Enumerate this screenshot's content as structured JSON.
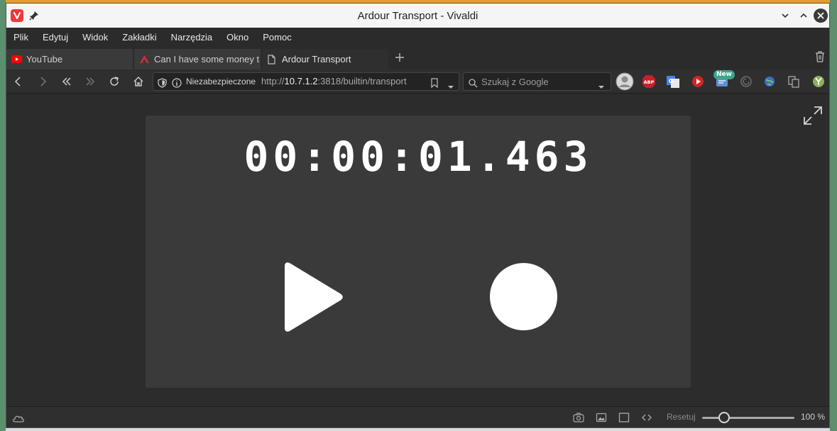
{
  "window": {
    "title": "Ardour Transport - Vivaldi"
  },
  "menu": {
    "items": [
      "Plik",
      "Edytuj",
      "Widok",
      "Zakładki",
      "Narzędzia",
      "Okno",
      "Pomoc"
    ]
  },
  "tabs": [
    {
      "label": "YouTube",
      "icon": "youtube-icon",
      "active": false
    },
    {
      "label": "Can I have some money t…",
      "icon": "ardour-icon",
      "active": false
    },
    {
      "label": "Ardour Transport",
      "icon": "document-icon",
      "active": true
    }
  ],
  "address": {
    "security_label": "Niezabezpieczone",
    "url_prefix": "http://",
    "url_host": "10.7.1.2",
    "url_rest": ":3818/builtin/transport"
  },
  "search": {
    "placeholder": "Szukaj z Google"
  },
  "extensions": {
    "new_badge": "New"
  },
  "transport": {
    "time": "00:00:01.463"
  },
  "status": {
    "reset_label": "Resetuj",
    "zoom_label": "100 %",
    "zoom_level": 1.0,
    "zoom_knob_fraction": 0.2
  },
  "colors": {
    "accent": "#ef3939",
    "background": "#2c2c2c",
    "panel": "#3a3a3a",
    "badge": "#3fa489"
  }
}
